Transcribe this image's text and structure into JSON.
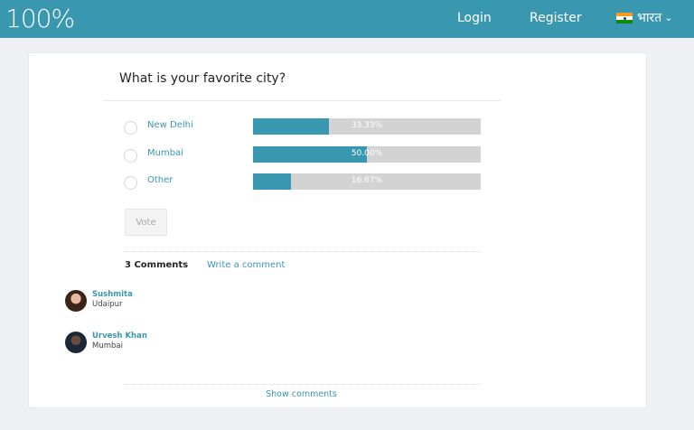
{
  "header": {
    "logo": "100%",
    "login": "Login",
    "register": "Register",
    "language": "भारत",
    "colors": {
      "bar": "#3a97b0"
    }
  },
  "poll": {
    "question": "What is your favorite city?",
    "options": [
      {
        "label": "New Delhi",
        "percent_text": "33.33%",
        "percent": 33.33
      },
      {
        "label": "Mumbai",
        "percent_text": "50.00%",
        "percent": 50.0
      },
      {
        "label": "Other",
        "percent_text": "16.67%",
        "percent": 16.67
      }
    ],
    "vote_label": "Vote"
  },
  "comments": {
    "count_label": "3 Comments",
    "write_label": "Write a comment",
    "items": [
      {
        "name": "Sushmita",
        "text": "Udaipur"
      },
      {
        "name": "Urvesh Khan",
        "text": "Mumbai"
      }
    ],
    "show_label": "Show comments"
  }
}
